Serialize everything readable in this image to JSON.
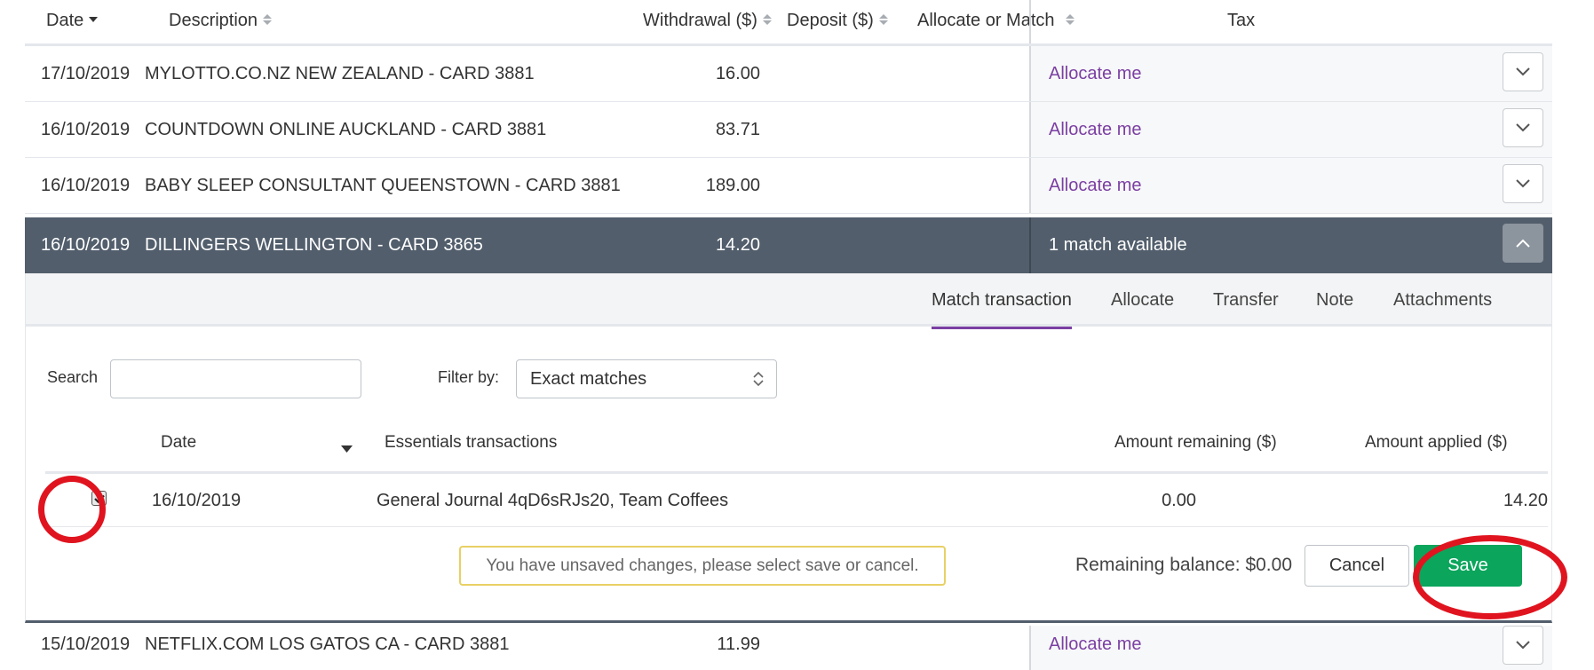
{
  "header": {
    "date": "Date",
    "description": "Description",
    "withdrawal": "Withdrawal ($)",
    "deposit": "Deposit ($)",
    "allocate": "Allocate or Match",
    "tax": "Tax"
  },
  "rows": [
    {
      "date": "17/10/2019",
      "description": "MYLOTTO.CO.NZ NEW ZEALAND - CARD 3881",
      "withdrawal": "16.00",
      "deposit": "",
      "action": "Allocate me"
    },
    {
      "date": "16/10/2019",
      "description": "COUNTDOWN ONLINE AUCKLAND - CARD 3881",
      "withdrawal": "83.71",
      "deposit": "",
      "action": "Allocate me"
    },
    {
      "date": "16/10/2019",
      "description": "BABY SLEEP CONSULTANT QUEENSTOWN - CARD 3881",
      "withdrawal": "189.00",
      "deposit": "",
      "action": "Allocate me"
    },
    {
      "date": "16/10/2019",
      "description": "DILLINGERS WELLINGTON - CARD 3865",
      "withdrawal": "14.20",
      "deposit": "",
      "action": "1 match available"
    },
    {
      "date": "15/10/2019",
      "description": "NETFLIX.COM LOS GATOS CA - CARD 3881",
      "withdrawal": "11.99",
      "deposit": "",
      "action": "Allocate me"
    }
  ],
  "tabs": [
    "Match transaction",
    "Allocate",
    "Transfer",
    "Note",
    "Attachments"
  ],
  "match": {
    "search_label": "Search",
    "search_value": "",
    "filter_label": "Filter by:",
    "filter_value": "Exact matches",
    "columns": {
      "date": "Date",
      "essentials": "Essentials transactions",
      "remaining": "Amount remaining ($)",
      "applied": "Amount applied ($)"
    },
    "row": {
      "checked": true,
      "date": "16/10/2019",
      "description": "General Journal 4qD6sRJs20, Team Coffees",
      "remaining": "0.00",
      "applied": "14.20"
    },
    "warning": "You have unsaved changes, please select save or cancel.",
    "balance": "Remaining balance: $0.00",
    "cancel": "Cancel",
    "save": "Save"
  },
  "colors": {
    "accent": "#7b3fa3",
    "selected_row": "#525e6c",
    "save_green": "#0ba55c",
    "highlight_red": "#e0141f",
    "warning_border": "#e8d064"
  }
}
